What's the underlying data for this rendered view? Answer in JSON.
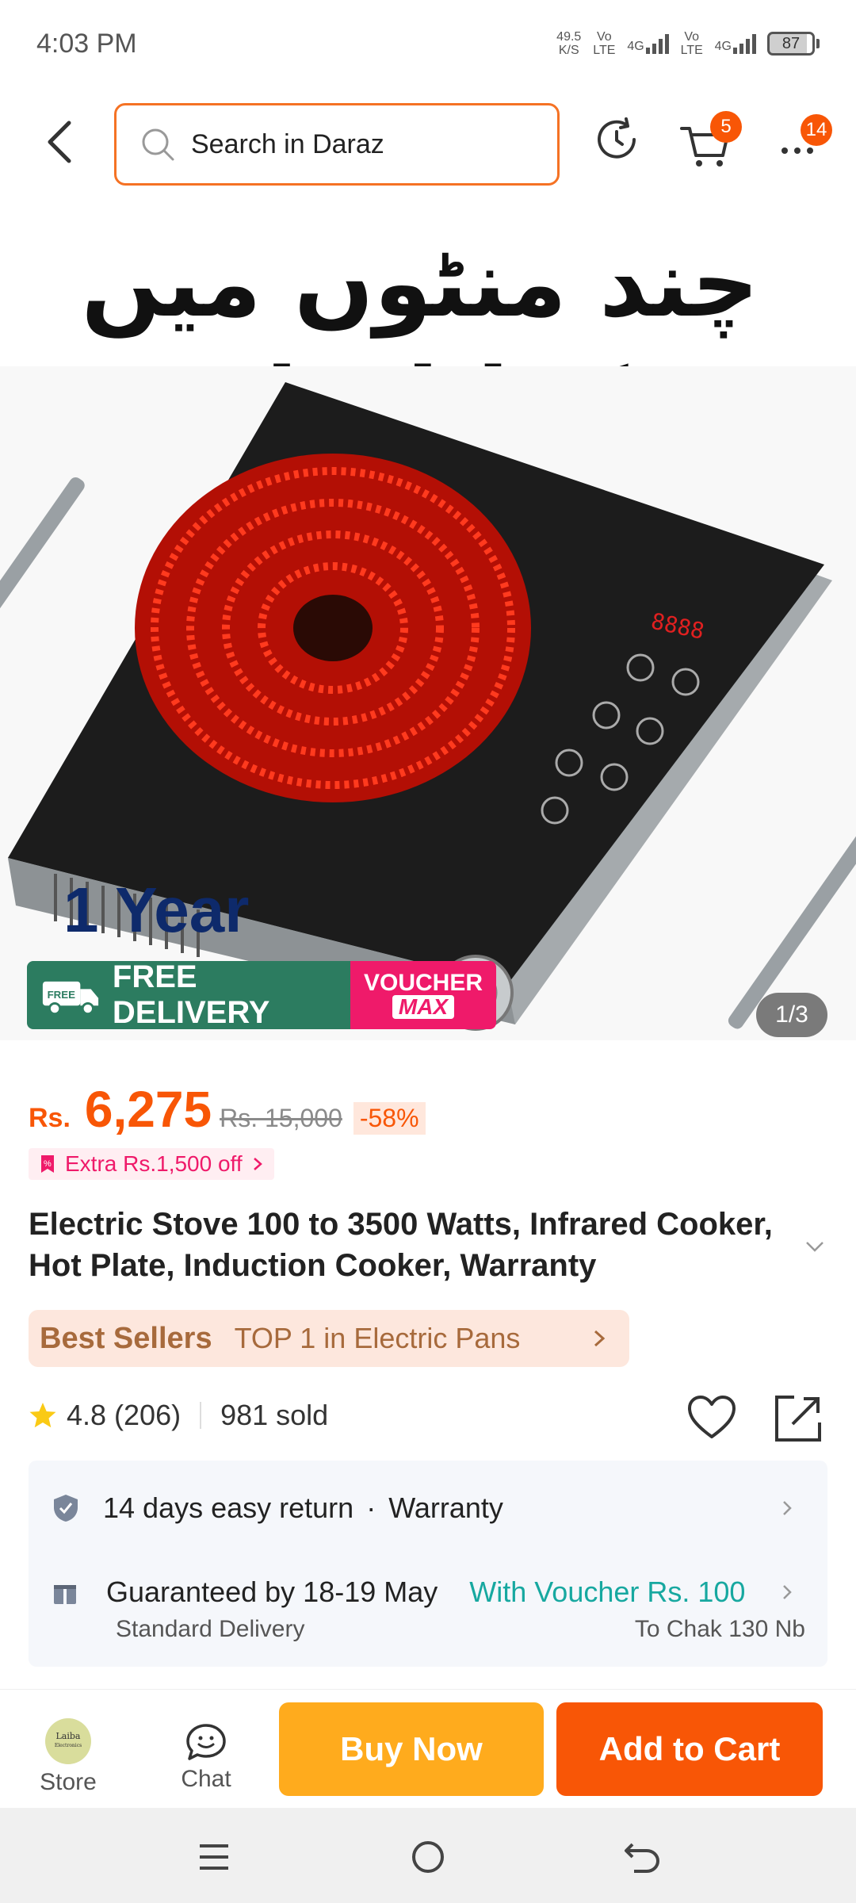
{
  "status_bar": {
    "time": "4:03 PM",
    "net_speed_value": "49.5",
    "net_speed_unit": "K/S",
    "volte_1": "Vo LTE",
    "net_1": "4G",
    "volte_2": "Vo LTE",
    "net_2": "4G",
    "battery": "87"
  },
  "top_bar": {
    "search_placeholder": "Search in Daraz",
    "cart_count": "5",
    "more_count": "14"
  },
  "hero": {
    "headline_urdu": "چند منٹوں میں کھانا تیار",
    "year_text": "1 Year",
    "free_delivery": "FREE DELIVERY",
    "voucher_line1": "VOUCHER",
    "voucher_line2": "MAX",
    "image_counter": "1/3"
  },
  "price": {
    "currency": "Rs.",
    "current": "6,275",
    "original": "Rs. 15,000",
    "discount": "-58%",
    "extra_off": "Extra Rs.1,500 off"
  },
  "product": {
    "title": "Electric Stove 100 to 3500 Watts, Infrared Cooker, Hot Plate, Induction Cooker, Warranty"
  },
  "best_seller": {
    "brand": "Best Sellers",
    "text": "TOP 1 in Electric Pans"
  },
  "rating": {
    "score": "4.8",
    "count": "(206)",
    "sold": "981 sold"
  },
  "services": {
    "return": "14 days easy return",
    "separator": "·",
    "warranty": "Warranty",
    "guarantee": "Guaranteed by 18-19 May",
    "voucher": "With Voucher Rs. 100",
    "delivery_type": "Standard Delivery",
    "delivery_to": "To Chak 130 Nb"
  },
  "bottom_bar": {
    "store_avatar_line1": "Laiba",
    "store_avatar_line2": "Electronics",
    "store_label": "Store",
    "chat_label": "Chat",
    "buy_now": "Buy Now",
    "add_to_cart": "Add to Cart"
  },
  "colors": {
    "brand_orange": "#f85606",
    "buy_now_yellow": "#ffab1d",
    "delivery_green": "#2c7c60",
    "voucher_pink": "#ef1a6a",
    "voucher_teal": "#17a8a0"
  }
}
